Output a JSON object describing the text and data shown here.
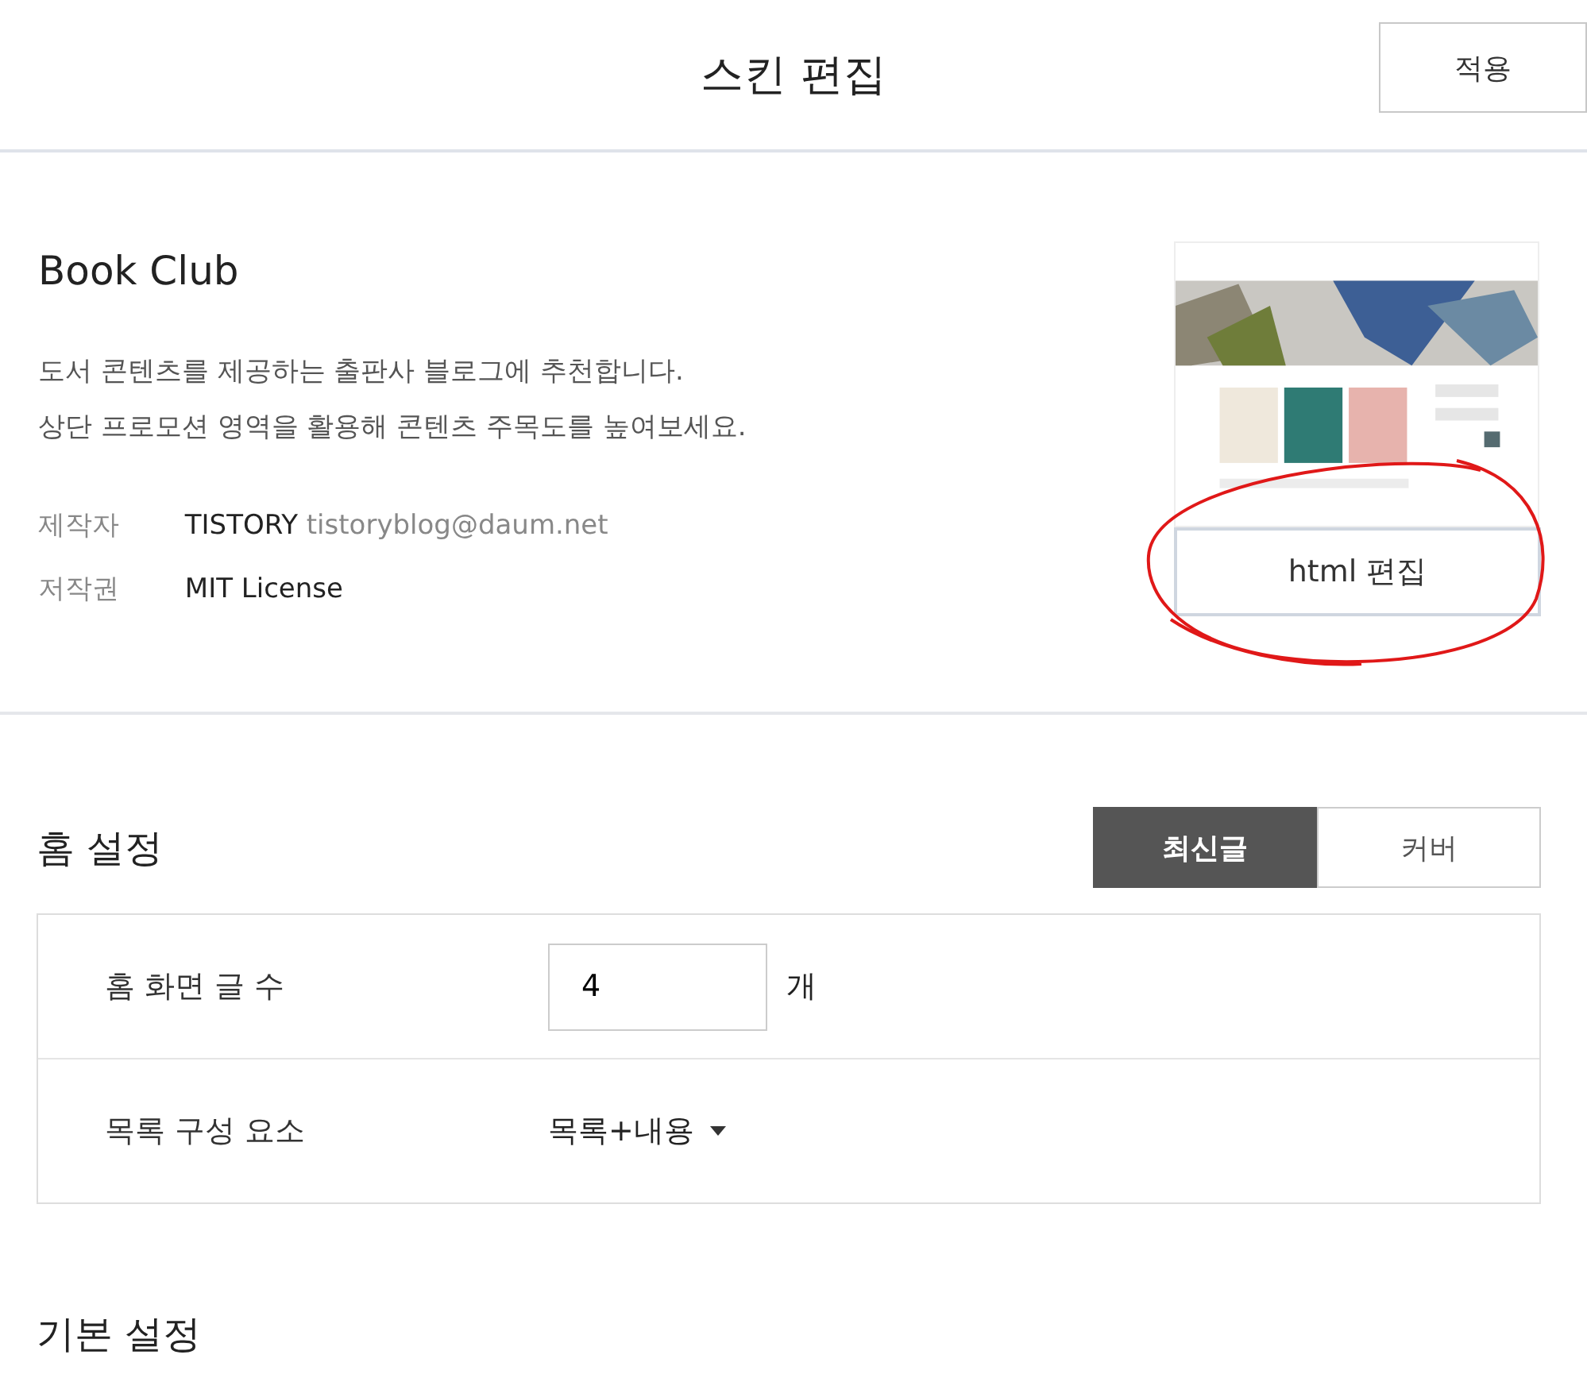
{
  "header": {
    "title": "스킨 편집",
    "apply_button": "적용"
  },
  "skin": {
    "name": "Book Club",
    "description": [
      "도서 콘텐츠를 제공하는 출판사 블로그에 추천합니다.",
      "상단 프로모션 영역을 활용해 콘텐츠 주목도를 높여보세요."
    ],
    "meta": [
      {
        "label": "제작자",
        "value": "TISTORY",
        "extra": "tistoryblog@daum.net"
      },
      {
        "label": "저작권",
        "value": "MIT License"
      }
    ],
    "edit_button": "html 편집"
  },
  "home_settings": {
    "title": "홈 설정",
    "modes": [
      {
        "label": "최신글",
        "selected": true
      },
      {
        "label": "커버",
        "selected": false
      }
    ],
    "rows": [
      {
        "kind": "number",
        "label": "홈 화면 글 수",
        "value": "4",
        "unit": "개"
      },
      {
        "kind": "select",
        "label": "목록 구성 요소",
        "value": "목록+내용"
      }
    ]
  },
  "basic_settings": {
    "title": "기본 설정"
  }
}
